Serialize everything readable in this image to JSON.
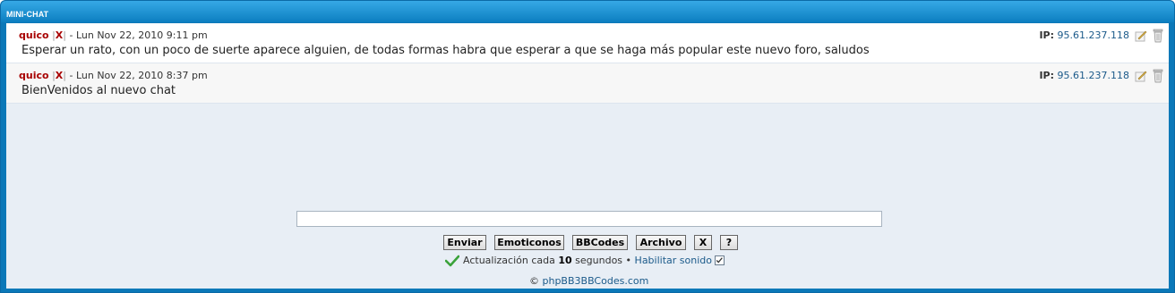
{
  "header": {
    "title": "MINI-CHAT"
  },
  "messages": [
    {
      "author": "quico",
      "kick": "X",
      "timestamp": "Lun Nov 22, 2010 9:11 pm",
      "text": "Esperar un rato, con un poco de suerte aparece alguien, de todas formas habra que esperar a que se haga más popular este nuevo foro, saludos",
      "ip_label": "IP:",
      "ip": "95.61.237.118"
    },
    {
      "author": "quico",
      "kick": "X",
      "timestamp": "Lun Nov 22, 2010 8:37 pm",
      "text": "BienVenidos al nuevo chat",
      "ip_label": "IP:",
      "ip": "95.61.237.118"
    }
  ],
  "input": {
    "value": "",
    "placeholder": ""
  },
  "buttons": {
    "send": "Enviar",
    "emoticons": "Emoticonos",
    "bbcodes": "BBCodes",
    "file": "Archivo",
    "clear": "X",
    "help": "?"
  },
  "status": {
    "prefix": "Actualización cada",
    "interval": "10",
    "suffix": "segundos",
    "bullet": "•",
    "sound_label": "Habilitar sonido",
    "sound_enabled": true
  },
  "footer": {
    "copyright": "©",
    "link": "phpBB3BBCodes.com"
  },
  "colors": {
    "header": "#0c7ec0",
    "author": "#a80000",
    "link": "#1b5a8a",
    "body_bg": "#e8eef5"
  },
  "icons": [
    "edit-icon",
    "delete-icon",
    "checkmark-icon"
  ]
}
